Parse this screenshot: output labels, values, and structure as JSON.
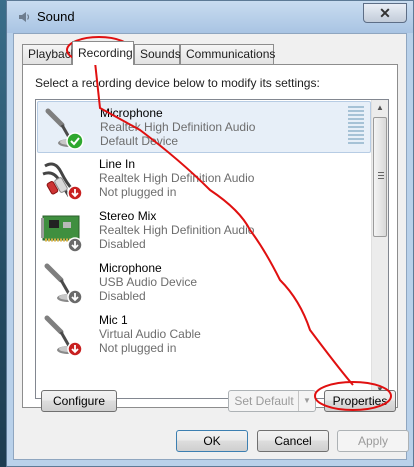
{
  "window": {
    "title": "Sound",
    "close_glyph": "✕"
  },
  "tabs": [
    {
      "label": "Playback",
      "active": false
    },
    {
      "label": "Recording",
      "active": true
    },
    {
      "label": "Sounds",
      "active": false
    },
    {
      "label": "Communications",
      "active": false
    }
  ],
  "instruction": "Select a recording device below to modify its settings:",
  "devices": [
    {
      "name": "Microphone",
      "driver": "Realtek High Definition Audio",
      "status": "Default Device",
      "icon": "microphone-icon",
      "badge": "green-check-badge",
      "selected": true
    },
    {
      "name": "Line In",
      "driver": "Realtek High Definition Audio",
      "status": "Not plugged in",
      "icon": "line-in-cable-icon",
      "badge": "red-down-arrow-badge",
      "selected": false
    },
    {
      "name": "Stereo Mix",
      "driver": "Realtek High Definition Audio",
      "status": "Disabled",
      "icon": "sound-card-icon",
      "badge": "gray-down-arrow-badge",
      "selected": false
    },
    {
      "name": "Microphone",
      "driver": "USB Audio Device",
      "status": "Disabled",
      "icon": "microphone-icon",
      "badge": "gray-down-arrow-badge",
      "selected": false
    },
    {
      "name": "Mic 1",
      "driver": "Virtual Audio Cable",
      "status": "Not plugged in",
      "icon": "microphone-icon",
      "badge": "red-down-arrow-badge",
      "selected": false
    }
  ],
  "buttons": {
    "configure": "Configure",
    "set_default": "Set Default",
    "properties": "Properties",
    "ok": "OK",
    "cancel": "Cancel",
    "apply": "Apply"
  },
  "colors": {
    "annotation": "#e01010",
    "selection": "#e7eff8",
    "check": "#2ea82e",
    "disabled_text": "#9b9b9b"
  }
}
